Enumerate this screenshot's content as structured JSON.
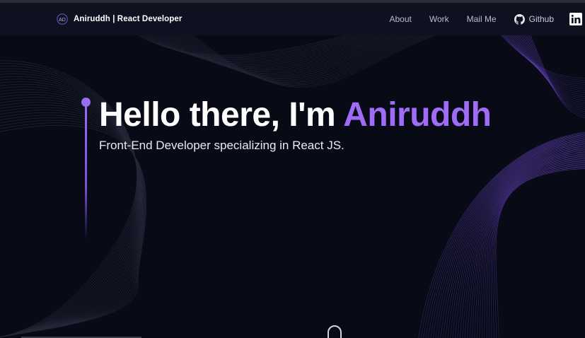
{
  "navbar": {
    "logo_text": "AD",
    "brand": "Aniruddh  | React Developer",
    "links": [
      "About",
      "Work",
      "Mail Me"
    ],
    "github_label": "Github",
    "linkedin_icon": "linkedin-icon",
    "github_icon": "github-icon"
  },
  "hero": {
    "title_prefix": "Hello there, I'm ",
    "title_name": "Aniruddh",
    "subtitle": "Front-End Developer specializing in React JS."
  },
  "colors": {
    "background": "#080b16",
    "navbar": "#0d1120",
    "accent": "#9e6cf6",
    "text": "#ffffff"
  }
}
